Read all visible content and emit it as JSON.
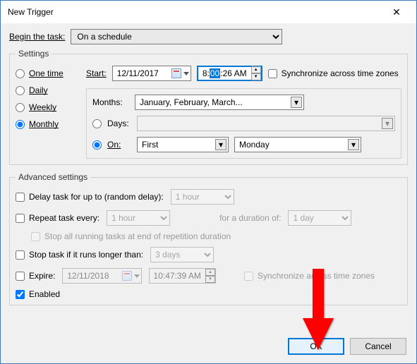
{
  "window": {
    "title": "New Trigger"
  },
  "begin_task": {
    "label": "Begin the task:",
    "value": "On a schedule"
  },
  "settings": {
    "legend": "Settings",
    "frequency": {
      "options": [
        "One time",
        "Daily",
        "Weekly",
        "Monthly"
      ],
      "selected": "Monthly"
    },
    "start": {
      "label": "Start:",
      "date": "12/11/2017",
      "time_prefix": "8:",
      "time_sel": "00",
      "time_suffix": ":26 AM"
    },
    "sync_tz": {
      "label": "Synchronize across time zones",
      "checked": false
    },
    "months": {
      "label": "Months:",
      "value": "January, February, March..."
    },
    "mode": {
      "days": {
        "label": "Days:",
        "selected": false,
        "value": ""
      },
      "on": {
        "label": "On:",
        "selected": true,
        "week": "First",
        "day": "Monday"
      }
    }
  },
  "advanced": {
    "legend": "Advanced settings",
    "delay": {
      "label": "Delay task for up to (random delay):",
      "value": "1 hour",
      "checked": false
    },
    "repeat": {
      "label": "Repeat task every:",
      "value": "1 hour",
      "duration_label": "for a duration of:",
      "duration_value": "1 day",
      "checked": false
    },
    "stop_running": {
      "label": "Stop all running tasks at end of repetition duration",
      "checked": false
    },
    "stop_if": {
      "label": "Stop task if it runs longer than:",
      "value": "3 days",
      "checked": false
    },
    "expire": {
      "label": "Expire:",
      "date": "12/11/2018",
      "time": "10:47:39 AM",
      "sync_label": "Synchronize across time zones",
      "checked": false
    },
    "enabled": {
      "label": "Enabled",
      "checked": true
    }
  },
  "buttons": {
    "ok": "OK",
    "cancel": "Cancel"
  }
}
